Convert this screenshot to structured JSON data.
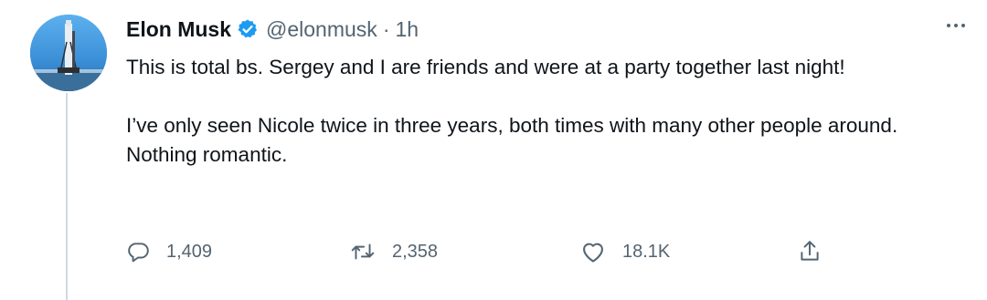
{
  "tweet": {
    "author": {
      "name": "Elon Musk",
      "handle": "@elonmusk",
      "verified": true,
      "avatar_icon": "rocket-launchpad-avatar"
    },
    "separator": "·",
    "time": "1h",
    "text": [
      "This is total bs. Sergey and I are friends and were at a party together last night!",
      "I’ve only seen Nicole twice in three years, both times with many other people around. Nothing romantic."
    ],
    "actions": {
      "reply_count": "1,409",
      "retweet_count": "2,358",
      "like_count": "18.1K"
    }
  },
  "colors": {
    "primary_text": "#0f1419",
    "secondary_text": "#536471",
    "verified_badge": "#1d9bf0",
    "thread_line": "#cfd9de"
  },
  "icons": {
    "more": "more-horizontal-icon",
    "reply": "reply-bubble-icon",
    "retweet": "retweet-icon",
    "like": "heart-icon",
    "share": "share-upload-icon"
  }
}
